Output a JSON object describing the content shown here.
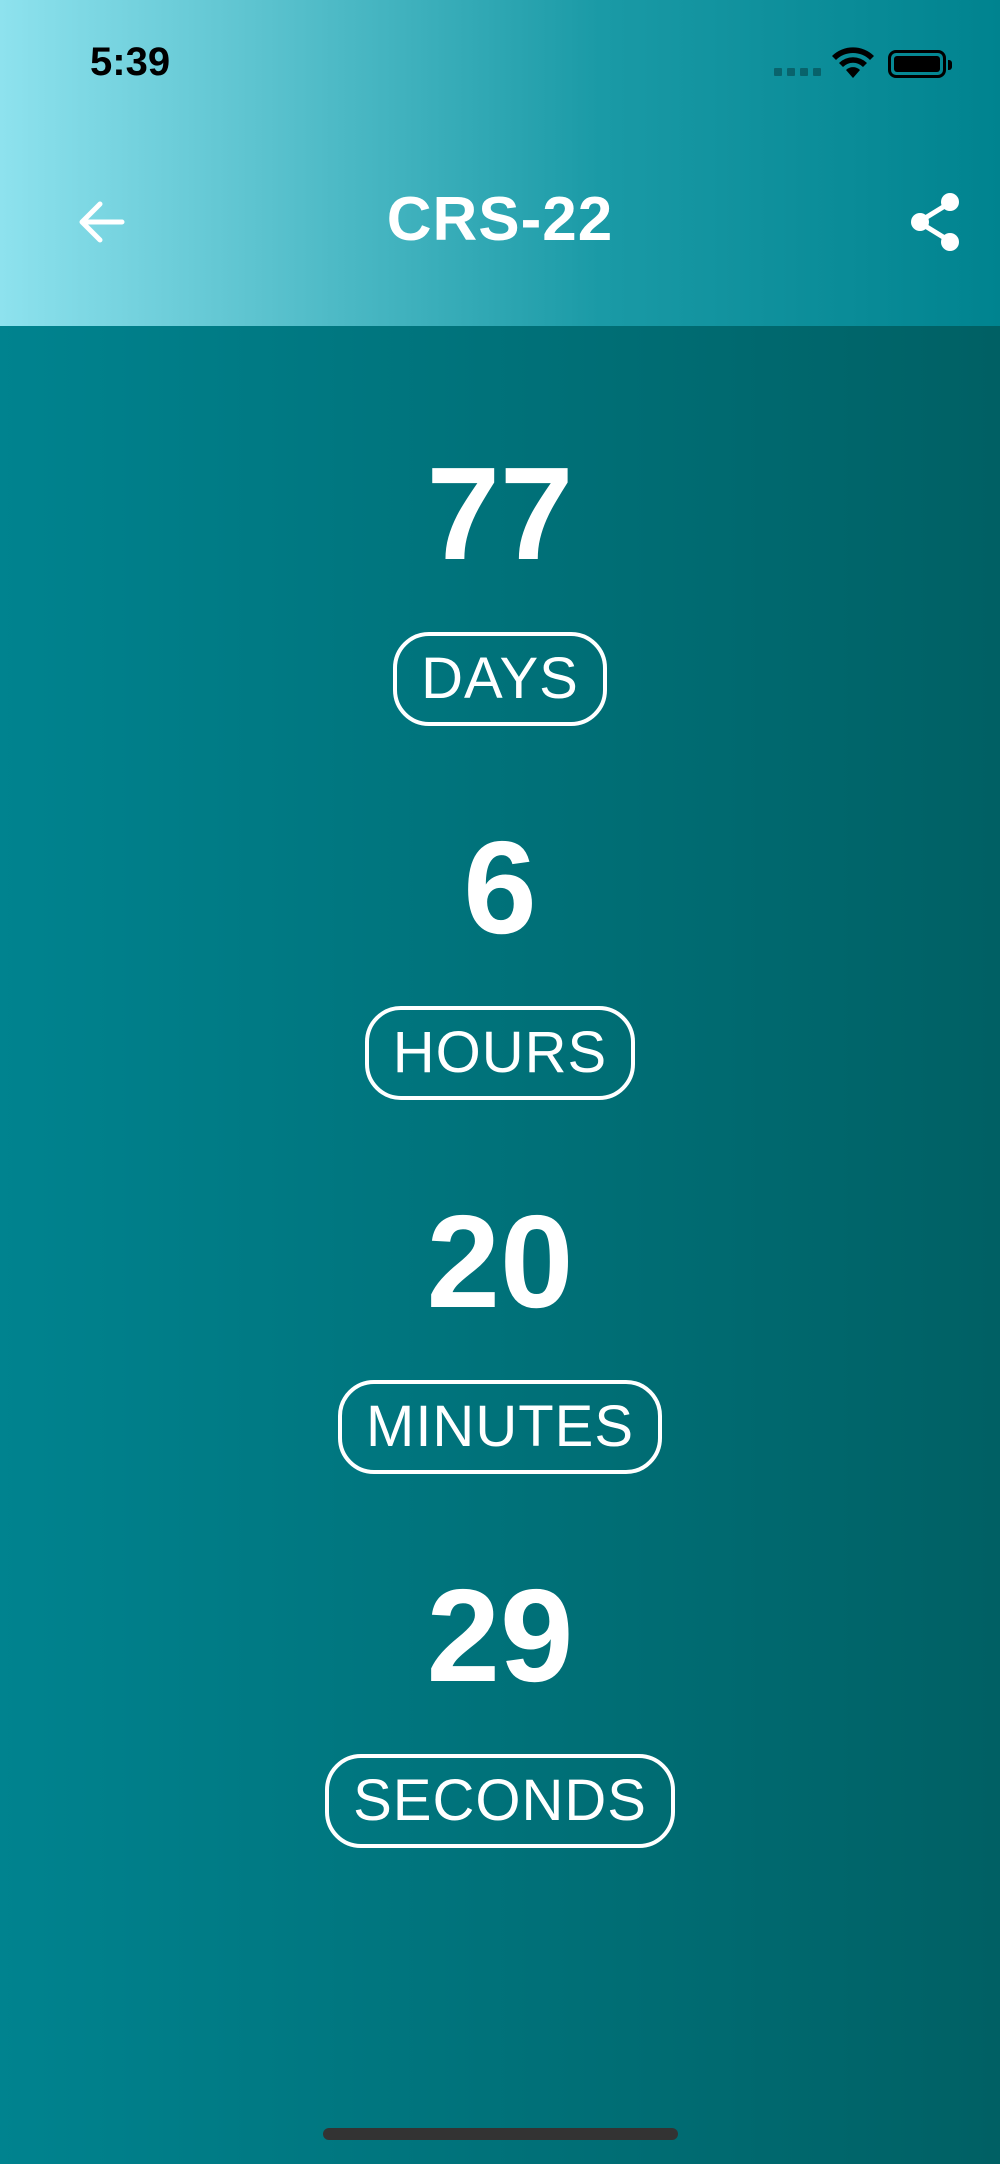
{
  "status_bar": {
    "time": "5:39"
  },
  "header": {
    "title": "CRS-22"
  },
  "countdown": {
    "days": {
      "value": "77",
      "label": "DAYS"
    },
    "hours": {
      "value": "6",
      "label": "HOURS"
    },
    "minutes": {
      "value": "20",
      "label": "MINUTES"
    },
    "seconds": {
      "value": "29",
      "label": "SECONDS"
    }
  },
  "icons": {
    "back": "arrow-left-icon",
    "share": "share-icon",
    "wifi": "wifi-icon",
    "battery": "battery-icon",
    "signal": "cellular-signal-icon"
  },
  "colors": {
    "header_gradient_start": "#8ee2ee",
    "header_gradient_end": "#00838f",
    "background_start": "#00838f",
    "background_end": "#006064",
    "text": "#ffffff"
  }
}
